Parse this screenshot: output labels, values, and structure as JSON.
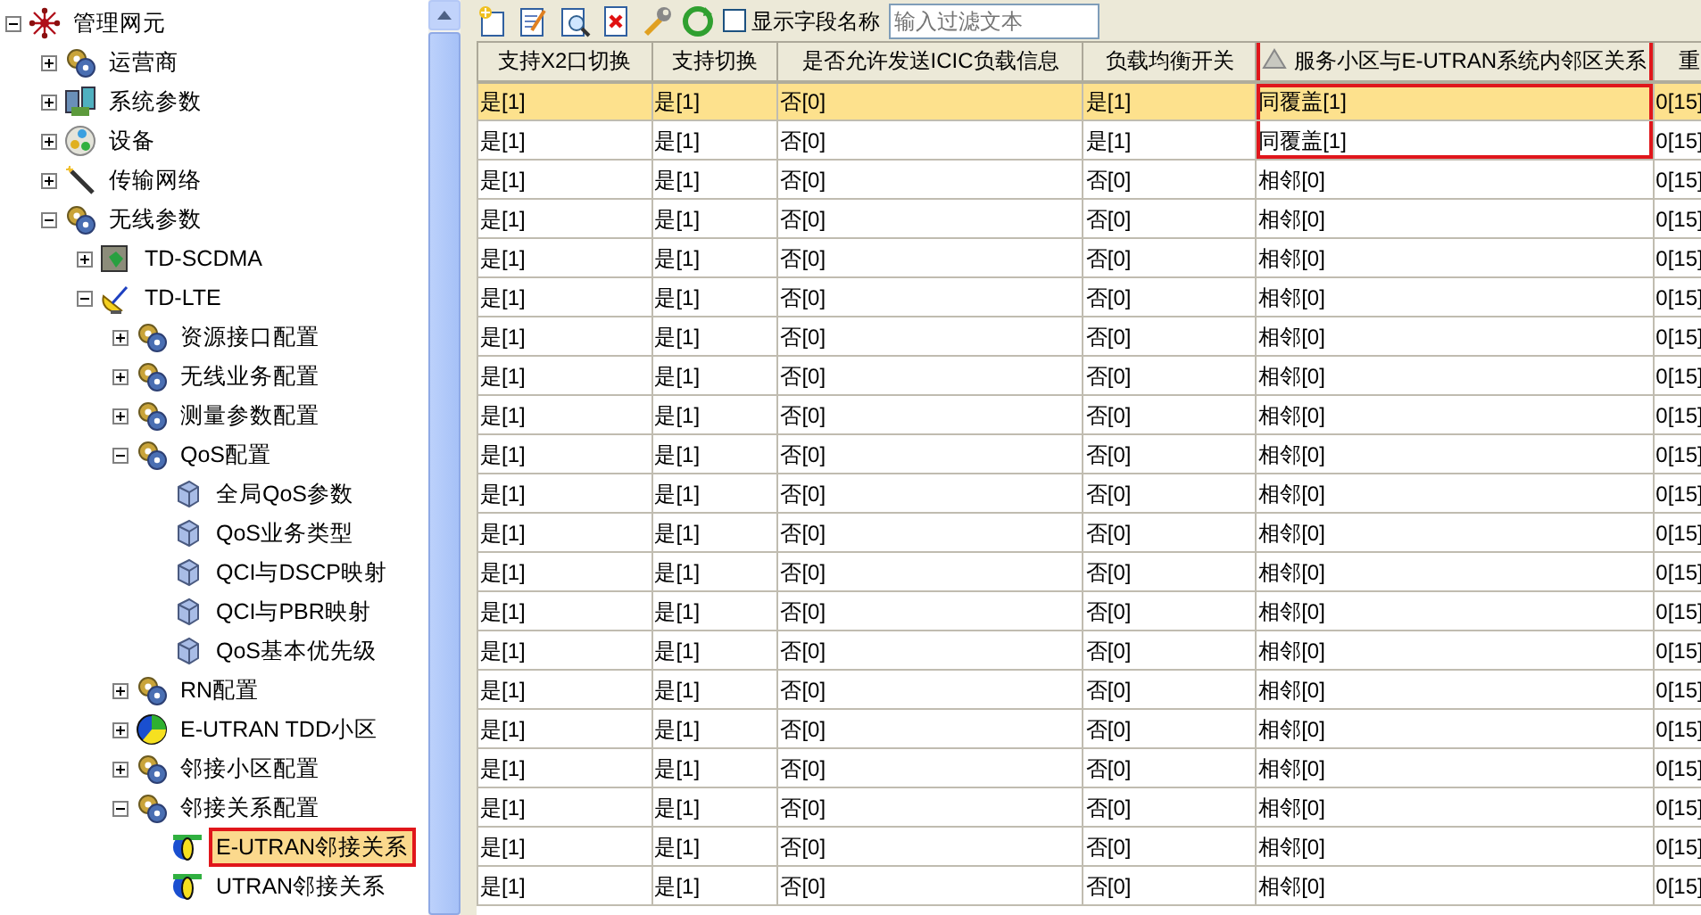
{
  "tree": [
    {
      "label": "管理网元",
      "kind": "network",
      "expanded": true,
      "children": [
        {
          "label": "运营商",
          "kind": "gears",
          "expanded": false
        },
        {
          "label": "系统参数",
          "kind": "servers",
          "expanded": false
        },
        {
          "label": "设备",
          "kind": "device",
          "expanded": false
        },
        {
          "label": "传输网络",
          "kind": "wand",
          "expanded": false
        },
        {
          "label": "无线参数",
          "kind": "gears",
          "expanded": true,
          "children": [
            {
              "label": "TD-SCDMA",
              "kind": "board",
              "expanded": false
            },
            {
              "label": "TD-LTE",
              "kind": "dish",
              "expanded": true,
              "children": [
                {
                  "label": "资源接口配置",
                  "kind": "gears",
                  "expanded": false
                },
                {
                  "label": "无线业务配置",
                  "kind": "gears",
                  "expanded": false
                },
                {
                  "label": "测量参数配置",
                  "kind": "gears",
                  "expanded": false
                },
                {
                  "label": "QoS配置",
                  "kind": "gears",
                  "expanded": true,
                  "children": [
                    {
                      "label": "全局QoS参数",
                      "kind": "cube"
                    },
                    {
                      "label": "QoS业务类型",
                      "kind": "cube"
                    },
                    {
                      "label": "QCI与DSCP映射",
                      "kind": "cube"
                    },
                    {
                      "label": "QCI与PBR映射",
                      "kind": "cube"
                    },
                    {
                      "label": "QoS基本优先级",
                      "kind": "cube"
                    }
                  ]
                },
                {
                  "label": "RN配置",
                  "kind": "gears",
                  "expanded": false
                },
                {
                  "label": "E-UTRAN TDD小区",
                  "kind": "pie",
                  "expanded": false
                },
                {
                  "label": "邻接小区配置",
                  "kind": "gears",
                  "expanded": false
                },
                {
                  "label": "邻接关系配置",
                  "kind": "gears",
                  "expanded": true,
                  "children": [
                    {
                      "label": "E-UTRAN邻接关系",
                      "kind": "pair",
                      "selected": true,
                      "boxed": true
                    },
                    {
                      "label": "UTRAN邻接关系",
                      "kind": "pair",
                      "selected": false,
                      "boxed": false
                    }
                  ]
                }
              ]
            }
          ]
        }
      ]
    }
  ],
  "toolbar": {
    "show_field_names": {
      "label": "显示字段名称",
      "checked": false
    },
    "filter": {
      "placeholder": "输入过滤文本"
    }
  },
  "table": {
    "columns": [
      {
        "label": "支持X2口切换",
        "sorted": false,
        "boxed": false
      },
      {
        "label": "支持切换",
        "sorted": false,
        "boxed": false
      },
      {
        "label": "是否允许发送ICIC负载信息",
        "sorted": false,
        "boxed": false
      },
      {
        "label": "负载均衡开关",
        "sorted": false,
        "boxed": false
      },
      {
        "label": "服务小区与E-UTRAN系统内邻区关系",
        "sorted": true,
        "boxed": true
      },
      {
        "label": "重",
        "sorted": false,
        "boxed": false
      }
    ],
    "rows": [
      {
        "selected": true,
        "boxed": true,
        "cells": [
          "是[1]",
          "是[1]",
          "否[0]",
          "是[1]",
          "同覆盖[1]",
          "0[15]"
        ]
      },
      {
        "selected": false,
        "boxed": true,
        "cells": [
          "是[1]",
          "是[1]",
          "否[0]",
          "是[1]",
          "同覆盖[1]",
          "0[15]"
        ]
      },
      {
        "selected": false,
        "boxed": false,
        "cells": [
          "是[1]",
          "是[1]",
          "否[0]",
          "否[0]",
          "相邻[0]",
          "0[15]"
        ]
      },
      {
        "selected": false,
        "boxed": false,
        "cells": [
          "是[1]",
          "是[1]",
          "否[0]",
          "否[0]",
          "相邻[0]",
          "0[15]"
        ]
      },
      {
        "selected": false,
        "boxed": false,
        "cells": [
          "是[1]",
          "是[1]",
          "否[0]",
          "否[0]",
          "相邻[0]",
          "0[15]"
        ]
      },
      {
        "selected": false,
        "boxed": false,
        "cells": [
          "是[1]",
          "是[1]",
          "否[0]",
          "否[0]",
          "相邻[0]",
          "0[15]"
        ]
      },
      {
        "selected": false,
        "boxed": false,
        "cells": [
          "是[1]",
          "是[1]",
          "否[0]",
          "否[0]",
          "相邻[0]",
          "0[15]"
        ]
      },
      {
        "selected": false,
        "boxed": false,
        "cells": [
          "是[1]",
          "是[1]",
          "否[0]",
          "否[0]",
          "相邻[0]",
          "0[15]"
        ]
      },
      {
        "selected": false,
        "boxed": false,
        "cells": [
          "是[1]",
          "是[1]",
          "否[0]",
          "否[0]",
          "相邻[0]",
          "0[15]"
        ]
      },
      {
        "selected": false,
        "boxed": false,
        "cells": [
          "是[1]",
          "是[1]",
          "否[0]",
          "否[0]",
          "相邻[0]",
          "0[15]"
        ]
      },
      {
        "selected": false,
        "boxed": false,
        "cells": [
          "是[1]",
          "是[1]",
          "否[0]",
          "否[0]",
          "相邻[0]",
          "0[15]"
        ]
      },
      {
        "selected": false,
        "boxed": false,
        "cells": [
          "是[1]",
          "是[1]",
          "否[0]",
          "否[0]",
          "相邻[0]",
          "0[15]"
        ]
      },
      {
        "selected": false,
        "boxed": false,
        "cells": [
          "是[1]",
          "是[1]",
          "否[0]",
          "否[0]",
          "相邻[0]",
          "0[15]"
        ]
      },
      {
        "selected": false,
        "boxed": false,
        "cells": [
          "是[1]",
          "是[1]",
          "否[0]",
          "否[0]",
          "相邻[0]",
          "0[15]"
        ]
      },
      {
        "selected": false,
        "boxed": false,
        "cells": [
          "是[1]",
          "是[1]",
          "否[0]",
          "否[0]",
          "相邻[0]",
          "0[15]"
        ]
      },
      {
        "selected": false,
        "boxed": false,
        "cells": [
          "是[1]",
          "是[1]",
          "否[0]",
          "否[0]",
          "相邻[0]",
          "0[15]"
        ]
      },
      {
        "selected": false,
        "boxed": false,
        "cells": [
          "是[1]",
          "是[1]",
          "否[0]",
          "否[0]",
          "相邻[0]",
          "0[15]"
        ]
      },
      {
        "selected": false,
        "boxed": false,
        "cells": [
          "是[1]",
          "是[1]",
          "否[0]",
          "否[0]",
          "相邻[0]",
          "0[15]"
        ]
      },
      {
        "selected": false,
        "boxed": false,
        "cells": [
          "是[1]",
          "是[1]",
          "否[0]",
          "否[0]",
          "相邻[0]",
          "0[15]"
        ]
      },
      {
        "selected": false,
        "boxed": false,
        "cells": [
          "是[1]",
          "是[1]",
          "否[0]",
          "否[0]",
          "相邻[0]",
          "0[15]"
        ]
      },
      {
        "selected": false,
        "boxed": false,
        "cells": [
          "是[1]",
          "是[1]",
          "否[0]",
          "否[0]",
          "相邻[0]",
          "0[15]"
        ]
      }
    ]
  }
}
